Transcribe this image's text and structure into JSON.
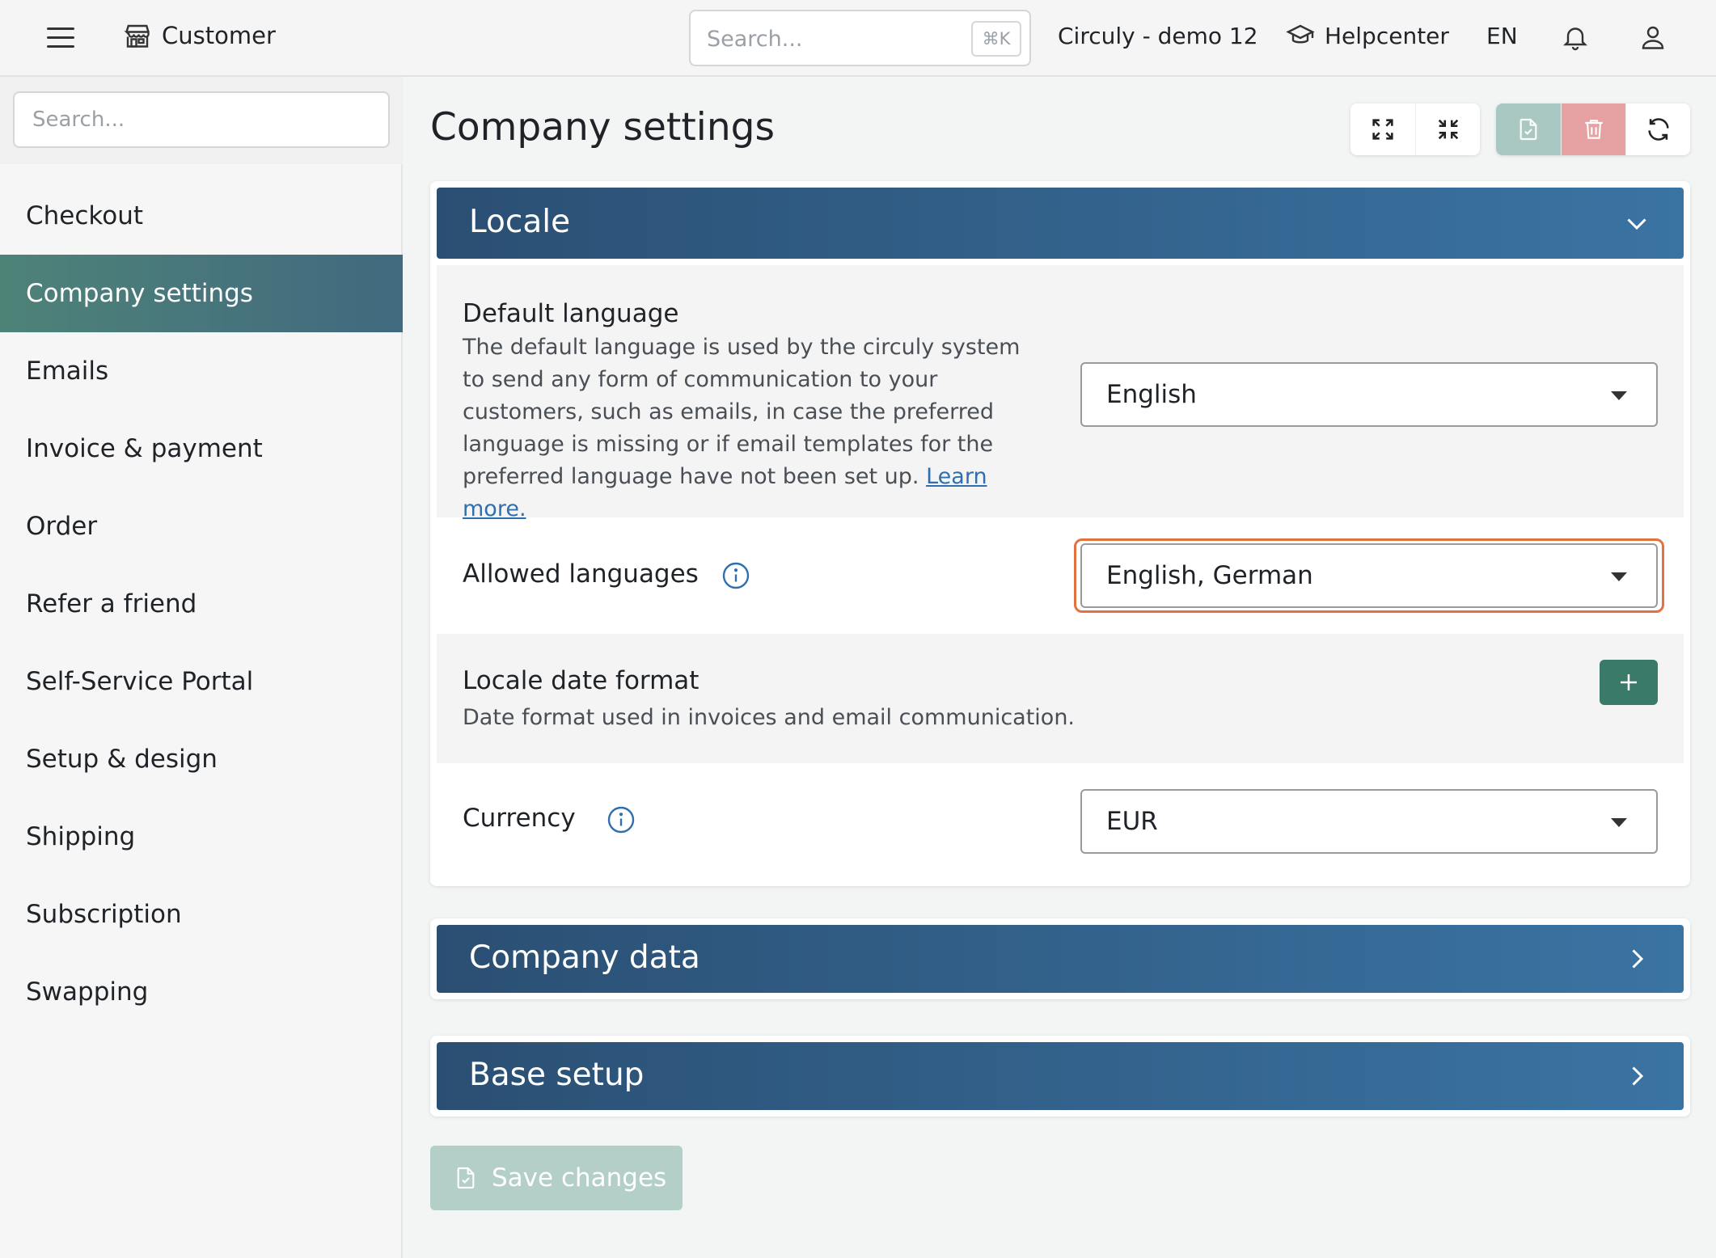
{
  "topbar": {
    "brand": "Customer",
    "search_placeholder": "Search...",
    "search_shortcut": "⌘K",
    "tenant": "Circuly - demo 12",
    "help": "Helpcenter",
    "language": "EN"
  },
  "sidebar": {
    "search_placeholder": "Search...",
    "items": [
      {
        "label": "Checkout",
        "active": false
      },
      {
        "label": "Company settings",
        "active": true
      },
      {
        "label": "Emails",
        "active": false
      },
      {
        "label": "Invoice & payment",
        "active": false
      },
      {
        "label": "Order",
        "active": false
      },
      {
        "label": "Refer a friend",
        "active": false
      },
      {
        "label": "Self-Service Portal",
        "active": false
      },
      {
        "label": "Setup & design",
        "active": false
      },
      {
        "label": "Shipping",
        "active": false
      },
      {
        "label": "Subscription",
        "active": false
      },
      {
        "label": "Swapping",
        "active": false
      }
    ]
  },
  "main": {
    "title": "Company settings",
    "locale": {
      "title": "Locale",
      "default_language": {
        "label": "Default language",
        "description": "The default language is used by the circuly system to send any form of communication to your customers, such as emails, in case the preferred language is missing or if email templates for the preferred language have not been set up.",
        "link": "Learn more.",
        "value": "English"
      },
      "allowed_languages": {
        "label": "Allowed languages",
        "value": "English, German"
      },
      "date_format": {
        "label": "Locale date format",
        "description": "Date format used in invoices and email communication."
      },
      "currency": {
        "label": "Currency",
        "value": "EUR"
      }
    },
    "company_data": {
      "title": "Company data"
    },
    "base_setup": {
      "title": "Base setup"
    },
    "save_label": "Save changes"
  },
  "colors": {
    "accent_green": "#3a7a68",
    "header_blue": "#2b4f73",
    "focus_orange": "#e2723f",
    "delete_red": "#e6a2a2"
  }
}
